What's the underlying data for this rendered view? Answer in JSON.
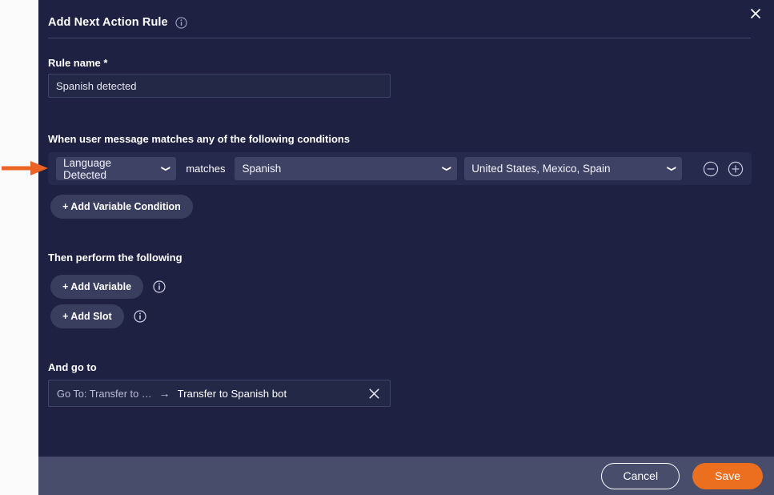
{
  "colors": {
    "modal_bg": "#1e2141",
    "page_bg": "#fbfbfb",
    "footer_bg": "#474d6b",
    "accent_orange": "#ec6f20",
    "field_bg": "#242847",
    "select_bg": "#3e4366",
    "pill_bg": "#393e5e",
    "row_bg": "#262a4d",
    "divider": "#41456a"
  },
  "modal": {
    "title": "Add Next Action Rule",
    "title_info_icon": "info-icon",
    "close_icon": "close-icon"
  },
  "rule_name": {
    "label": "Rule name *",
    "value": "Spanish detected",
    "placeholder": "Rule name"
  },
  "conditions": {
    "label": "When user message matches any of the following conditions",
    "rows": [
      {
        "field": "Language Detected",
        "operator": "matches",
        "value": "Spanish",
        "extra": "United States, Mexico, Spain",
        "remove_icon": "minus-circle-icon",
        "add_icon": "plus-circle-icon"
      }
    ],
    "add_variable_condition_label": "+ Add Variable Condition"
  },
  "actions": {
    "label": "Then perform the following",
    "add_variable_label": "+ Add Variable",
    "add_variable_info_icon": "info-icon",
    "add_slot_label": "+ Add Slot",
    "add_slot_info_icon": "info-icon"
  },
  "goto": {
    "label": "And go to",
    "source": "Go To: Transfer to …",
    "arrow": "→",
    "target": "Transfer to Spanish bot",
    "remove_icon": "close-icon"
  },
  "footer": {
    "cancel_label": "Cancel",
    "save_label": "Save"
  },
  "annotation": {
    "arrow_icon": "right-arrow-annotation",
    "color": "#ec6326"
  }
}
